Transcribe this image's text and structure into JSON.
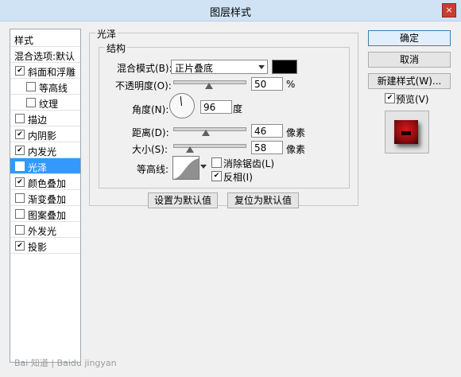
{
  "window": {
    "title": "图层样式",
    "close_label": "×"
  },
  "sidebar": {
    "items": [
      {
        "label": "样式",
        "checkbox": false,
        "checked": false,
        "indent": 0,
        "selected": false
      },
      {
        "label": "混合选项:默认",
        "checkbox": false,
        "checked": false,
        "indent": 0,
        "selected": false
      },
      {
        "label": "斜面和浮雕",
        "checkbox": true,
        "checked": true,
        "indent": 0,
        "selected": false
      },
      {
        "label": "等高线",
        "checkbox": true,
        "checked": false,
        "indent": 1,
        "selected": false
      },
      {
        "label": "纹理",
        "checkbox": true,
        "checked": false,
        "indent": 1,
        "selected": false
      },
      {
        "label": "描边",
        "checkbox": true,
        "checked": false,
        "indent": 0,
        "selected": false
      },
      {
        "label": "内阴影",
        "checkbox": true,
        "checked": true,
        "indent": 0,
        "selected": false
      },
      {
        "label": "内发光",
        "checkbox": true,
        "checked": true,
        "indent": 0,
        "selected": false
      },
      {
        "label": "光泽",
        "checkbox": true,
        "checked": true,
        "indent": 0,
        "selected": true
      },
      {
        "label": "颜色叠加",
        "checkbox": true,
        "checked": true,
        "indent": 0,
        "selected": false
      },
      {
        "label": "渐变叠加",
        "checkbox": true,
        "checked": false,
        "indent": 0,
        "selected": false
      },
      {
        "label": "图案叠加",
        "checkbox": true,
        "checked": false,
        "indent": 0,
        "selected": false
      },
      {
        "label": "外发光",
        "checkbox": true,
        "checked": false,
        "indent": 0,
        "selected": false
      },
      {
        "label": "投影",
        "checkbox": true,
        "checked": true,
        "indent": 0,
        "selected": false
      }
    ]
  },
  "panel": {
    "section_title": "光泽",
    "group_title": "结构",
    "blend_mode_label": "混合模式(B):",
    "blend_mode_value": "正片叠底",
    "opacity_label": "不透明度(O):",
    "opacity_value": "50",
    "opacity_unit": "%",
    "opacity_fraction": 0.5,
    "angle_label": "角度(N):",
    "angle_value": "96",
    "angle_unit": "度",
    "distance_label": "距离(D):",
    "distance_value": "46",
    "distance_unit": "像素",
    "distance_fraction": 0.46,
    "size_label": "大小(S):",
    "size_value": "58",
    "size_unit": "像素",
    "size_fraction": 0.23,
    "contour_label": "等高线:",
    "antialias_label": "消除锯齿(L)",
    "antialias_checked": false,
    "invert_label": "反相(I)",
    "invert_checked": true,
    "reset_default_button": "设置为默认值",
    "restore_default_button": "复位为默认值"
  },
  "right": {
    "ok_button": "确定",
    "cancel_button": "取消",
    "new_style_button": "新建样式(W)...",
    "preview_label": "预览(V)",
    "preview_checked": true
  },
  "colors": {
    "gloss_color": "#000000",
    "selection": "#3399ff",
    "preview_red": "#c0141a"
  },
  "watermark": "Bai 知道 | Baidu jingyan"
}
